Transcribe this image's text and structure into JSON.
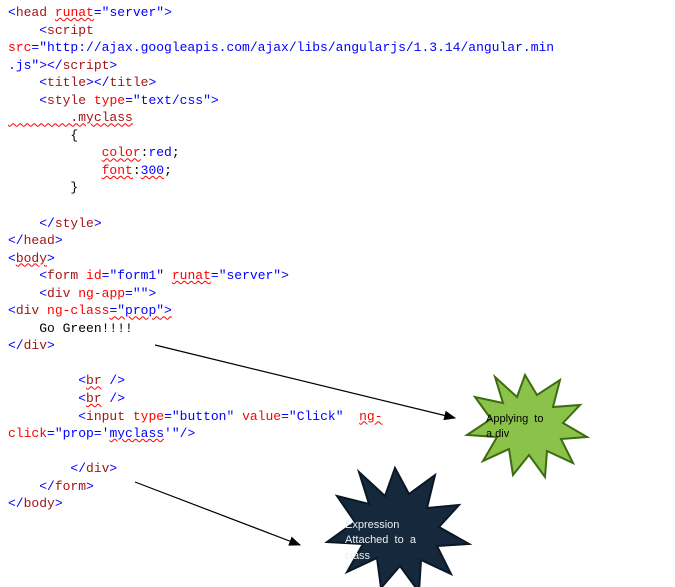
{
  "code": {
    "l1a": "<",
    "l1b": "head",
    "l1c": " ",
    "l1d": "runat",
    "l1e": "=\"server\">",
    "l2a": "    <",
    "l2b": "script",
    "l2c": " ",
    "l3a": "src",
    "l3b": "=\"http://ajax.googleapis.com/ajax/libs/angularjs/1.3.14/angular.min",
    "l3c": "",
    "l4a": ".js\"></",
    "l4b": "script",
    "l4c": ">",
    "l5a": "    <",
    "l5b": "title",
    "l5c": "></",
    "l5d": "title",
    "l5e": ">",
    "l6a": "    <",
    "l6b": "style",
    "l6c": " ",
    "l6d": "type",
    "l6e": "=\"text/css\">",
    "l7": "        .myclass",
    "l8": "        {",
    "l9a": "            ",
    "l9b": "color",
    "l9c": ":",
    "l9d": "red",
    "l9e": ";",
    "l10a": "            ",
    "l10b": "font",
    "l10c": ":",
    "l10d": "300",
    "l10e": ";",
    "l11": "        }",
    "l12": "",
    "l13a": "    </",
    "l13b": "style",
    "l13c": ">",
    "l14a": "</",
    "l14b": "head",
    "l14c": ">",
    "l15a": "<",
    "l15b": "body",
    "l15c": ">",
    "l16a": "    <",
    "l16b": "form",
    "l16c": " ",
    "l16d": "id",
    "l16e": "=\"form1\" ",
    "l16f": "runat",
    "l16g": "=\"server\">",
    "l17a": "    <",
    "l17b": "div",
    "l17c": " ",
    "l17d": "ng-app",
    "l17e": "=\"\">",
    "l18a": "<",
    "l18b": "div",
    "l18c": " ",
    "l18d": "ng-class",
    "l18e": "=\"prop\">",
    "l19": "    Go Green!!!!",
    "l20a": "</",
    "l20b": "div",
    "l20c": ">",
    "l21": "",
    "l22a": "         <",
    "l22b": "br",
    "l22c": " />",
    "l23a": "         <",
    "l23b": "br",
    "l23c": " />",
    "l24a": "         <",
    "l24b": "input",
    "l24c": " ",
    "l24d": "type",
    "l24e": "=\"button\" ",
    "l24f": "value",
    "l24g": "=\"Click\"  ",
    "l24h": "ng-",
    "l25a": "click",
    "l25b": "=\"prop='",
    "l25c": "myclass",
    "l25d": "'\"/>",
    "l26": "",
    "l27a": "        </",
    "l27b": "div",
    "l27c": ">",
    "l28a": "    </",
    "l28b": "form",
    "l28c": ">",
    "l29a": "</",
    "l29b": "body",
    "l29c": ">"
  },
  "callouts": {
    "applying": "Applying  to\na div",
    "expression": "Expression\nAttached  to  a\nclass"
  },
  "colors": {
    "starGreenFill": "#8bc34a",
    "starGreenStroke": "#3d6b0f",
    "starNavyFill": "#15283c",
    "starNavyStroke": "#0a1826",
    "arrow": "#000000"
  }
}
